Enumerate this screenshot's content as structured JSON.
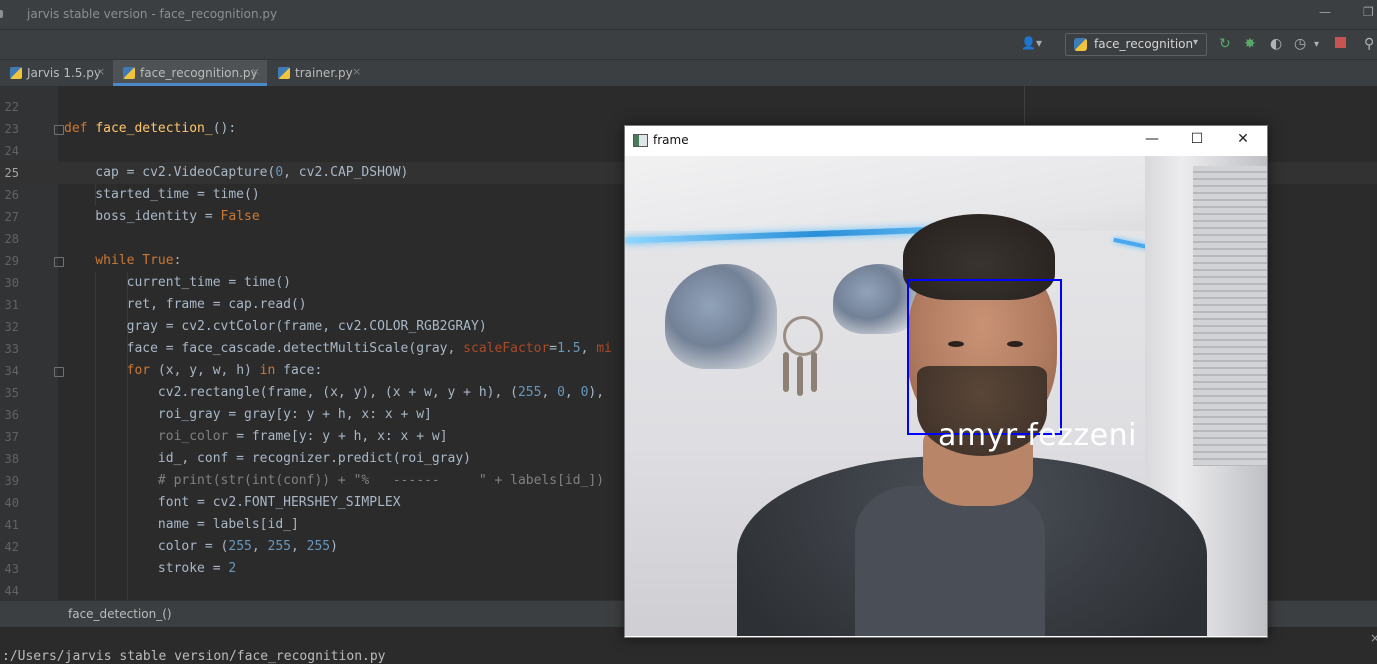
{
  "window": {
    "title": "jarvis stable version - face_recognition.py",
    "minimize_label": "—",
    "restore_label": "❐"
  },
  "toolbar": {
    "user_label": "👤▾",
    "run_config_label": "face_recognition",
    "run_config_arrow": "▾"
  },
  "tabs": [
    {
      "label": "Jarvis 1.5.py",
      "close": "×",
      "active": false
    },
    {
      "label": "face_recognition.py",
      "close": "×",
      "active": true
    },
    {
      "label": "trainer.py",
      "close": "×",
      "active": false
    }
  ],
  "editor": {
    "line_numbers": [
      "22",
      "23",
      "24",
      "25",
      "26",
      "27",
      "28",
      "29",
      "30",
      "31",
      "32",
      "33",
      "34",
      "35",
      "36",
      "37",
      "38",
      "39",
      "40",
      "41",
      "42",
      "43",
      "44"
    ],
    "current_line": "25",
    "code": {
      "l23_kw": "def ",
      "l23_fn": "face_detection_",
      "l23_rest": "():",
      "l25_a": "    cap = cv2.VideoCapture(",
      "l25_n1": "0",
      "l25_b": ", cv2.CAP_DSHOW)",
      "l26": "    started_time = time()",
      "l27_a": "    boss_identity = ",
      "l27_kw": "False",
      "l29_kw1": "    while ",
      "l29_kw2": "True",
      "l29_b": ":",
      "l30": "        current_time = time()",
      "l31": "        ret, frame = cap.read()",
      "l32": "        gray = cv2.cvtColor(frame, cv2.COLOR_RGB2GRAY)",
      "l33_a": "        face = face_cascade.detectMultiScale(gray, ",
      "l33_p": "scaleFactor",
      "l33_b": "=",
      "l33_n": "1.5",
      "l33_c": ", ",
      "l33_p2": "mi",
      "l34_kw": "        for ",
      "l34_a": "(x, y, w, h) ",
      "l34_kw2": "in ",
      "l34_b": "face:",
      "l35_a": "            cv2.rectangle(frame, (x, y), (x + w, y + h), (",
      "l35_n1": "255",
      "l35_c1": ", ",
      "l35_n2": "0",
      "l35_c2": ", ",
      "l35_n3": "0",
      "l35_b": "),",
      "l36": "            roi_gray = gray[y: y + h, x: x + w]",
      "l37_a": "            ",
      "l37_cmt": "roi_color",
      "l37_b": " = frame[y: y + h, x: x + w]",
      "l38": "            id_, conf = recognizer.predict(roi_gray)",
      "l39": "            # print(str(int(conf)) + \"%   ------     \" + labels[id_])",
      "l40": "            font = cv2.FONT_HERSHEY_SIMPLEX",
      "l41": "            name = labels[id_]",
      "l42_a": "            color = (",
      "l42_n1": "255",
      "l42_c1": ", ",
      "l42_n2": "255",
      "l42_c2": ", ",
      "l42_n3": "255",
      "l42_b": ")",
      "l43_a": "            stroke = ",
      "l43_n": "2"
    }
  },
  "breadcrumb": "face_detection_()",
  "bottom_panel": {
    "path_text": "  :/Users/jarvis stable version/face_recognition.py",
    "close": "×"
  },
  "frame_window": {
    "title": "frame",
    "minimize": "—",
    "maximize": "☐",
    "close": "✕",
    "detected_name": "amyr-fezzeni",
    "box_color": "#0000ff"
  }
}
